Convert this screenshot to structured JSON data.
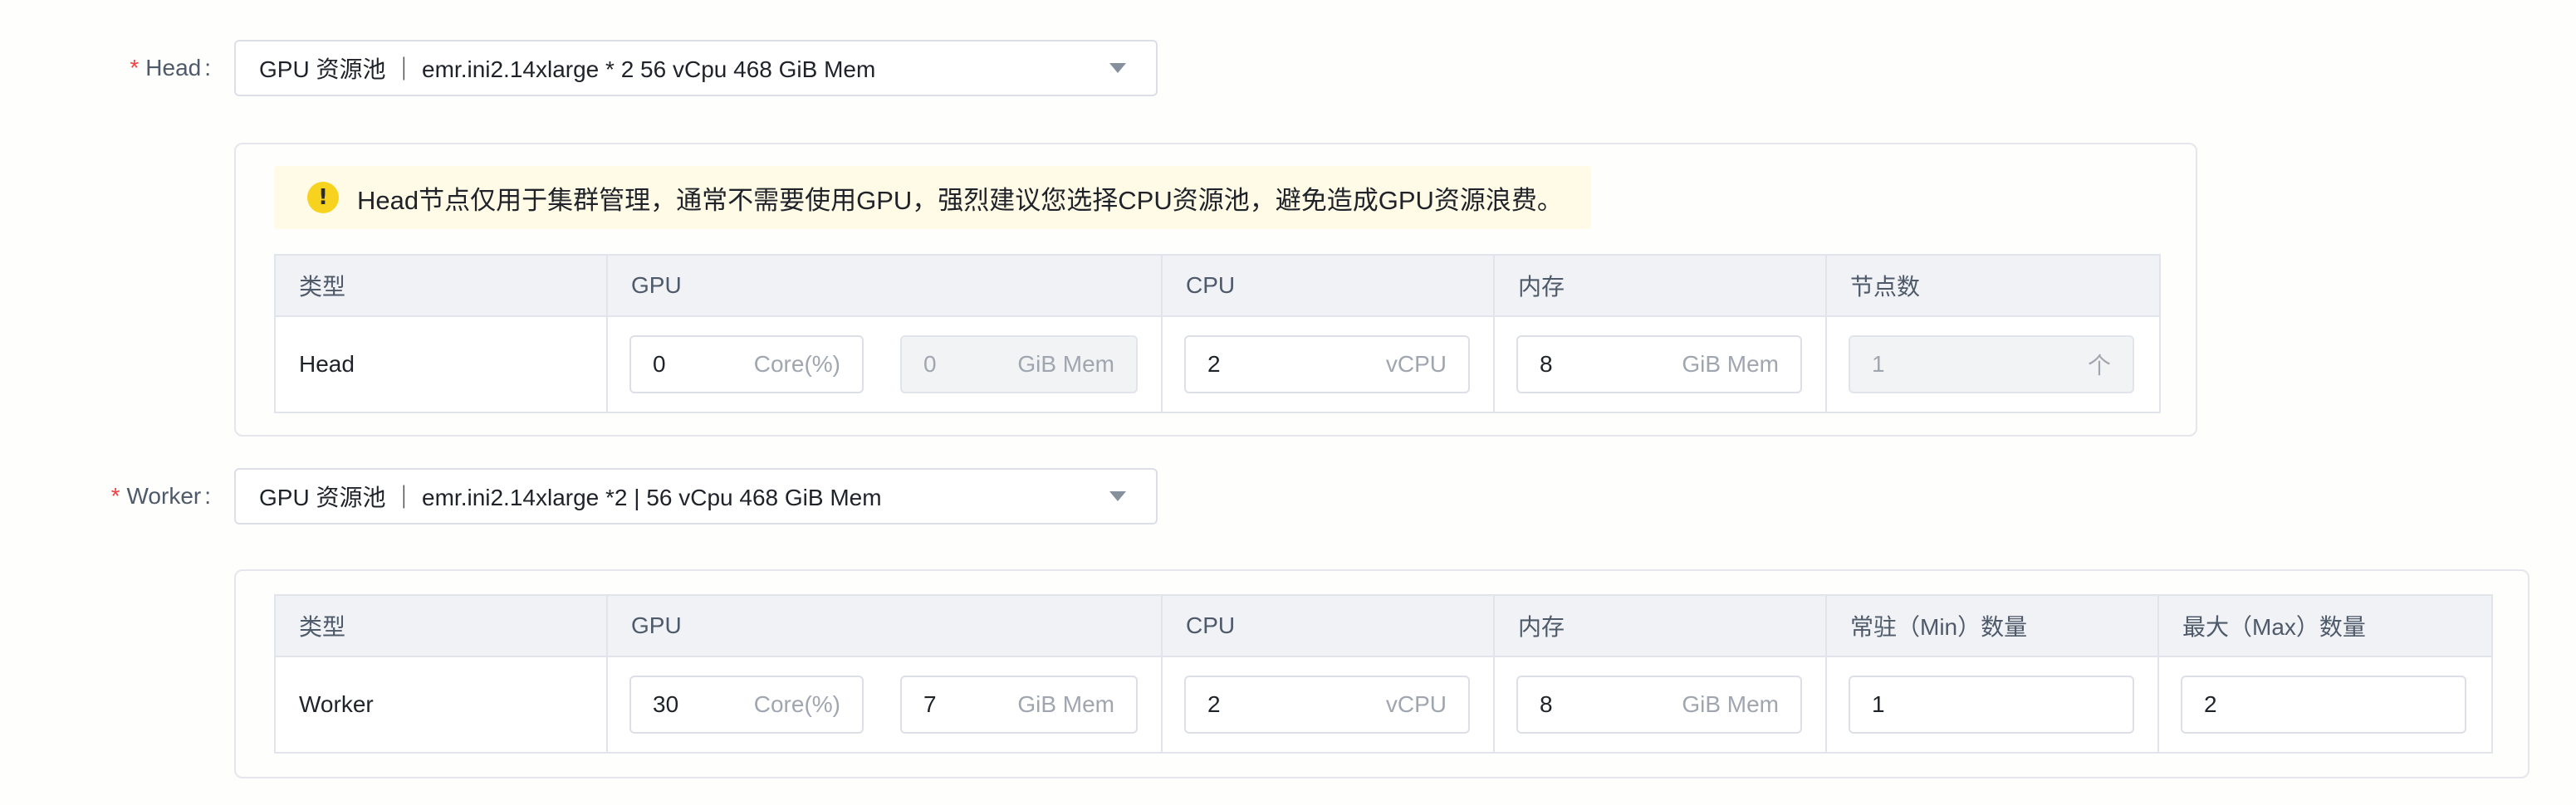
{
  "head": {
    "required_mark": "*",
    "label": "Head",
    "colon": ":",
    "select_value": "GPU 资源池 ｜ emr.ini2.14xlarge * 2  56 vCpu 468 GiB Mem",
    "warning_text": "Head节点仅用于集群管理，通常不需要使用GPU，强烈建议您选择CPU资源池，避免造成GPU资源浪费。",
    "warning_icon": "exclamation-icon",
    "columns": [
      "类型",
      "GPU",
      "CPU",
      "内存",
      "节点数"
    ],
    "row": {
      "type": "Head",
      "gpu_core": "0",
      "gpu_core_unit": "Core(%)",
      "gpu_mem": "0",
      "gpu_mem_unit": "GiB Mem",
      "cpu": "2",
      "cpu_unit": "vCPU",
      "mem": "8",
      "mem_unit": "GiB Mem",
      "nodes": "1",
      "nodes_unit": "个"
    }
  },
  "worker": {
    "required_mark": "*",
    "label": "Worker",
    "colon": ":",
    "select_value": "GPU 资源池 ｜ emr.ini2.14xlarge *2 | 56 vCpu 468 GiB Mem",
    "columns": [
      "类型",
      "GPU",
      "CPU",
      "内存",
      "常驻（Min）数量",
      "最大（Max）数量"
    ],
    "row": {
      "type": "Worker",
      "gpu_core": "30",
      "gpu_core_unit": "Core(%)",
      "gpu_mem": "7",
      "gpu_mem_unit": "GiB Mem",
      "cpu": "2",
      "cpu_unit": "vCPU",
      "mem": "8",
      "mem_unit": "GiB Mem",
      "min": "1",
      "max": "2"
    }
  },
  "colors": {
    "required": "#f53f3f",
    "warning_bg": "#fffbe6",
    "warning_icon": "#f7d21e",
    "header_bg": "#f0f2f5"
  }
}
